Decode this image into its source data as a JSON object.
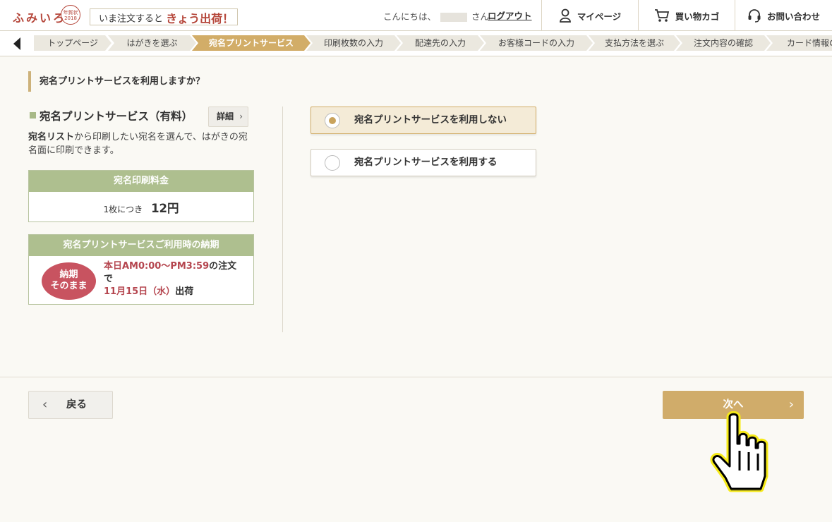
{
  "header": {
    "logo_text": "ふみいろ",
    "logo_seal": "年賀状2018",
    "banner_prefix": "いま注文すると",
    "banner_highlight": "きょう出荷！",
    "greeting_prefix": "こんにちは、",
    "greeting_suffix": "さん",
    "logout": "ログアウト",
    "nav": {
      "mypage": "マイページ",
      "cart": "買い物カゴ",
      "inquiry": "お問い合わせ"
    }
  },
  "breadcrumb": [
    "トップページ",
    "はがきを選ぶ",
    "宛名プリントサービス",
    "印刷枚数の入力",
    "配達先の入力",
    "お客様コードの入力",
    "支払方法を選ぶ",
    "注文内容の確認",
    "カード情報の"
  ],
  "breadcrumb_active_index": 2,
  "main": {
    "question": "宛名プリントサービスを利用しますか？",
    "service_title": "宛名プリントサービス（有料）",
    "detail_button": "詳細",
    "desc_bold": "宛名リスト",
    "desc_rest": "から印刷したい宛名を選んで、はがきの宛名面に印刷できます。",
    "price_box": {
      "title": "宛名印刷料金",
      "unit_label": "1枚につき",
      "price": "12円"
    },
    "delivery_box": {
      "title": "宛名プリントサービスご利用時の納期",
      "badge_line1": "納期",
      "badge_line2": "そのまま",
      "time_range": "本日AM0:00〜PM3:59",
      "order_suffix": "の注文で",
      "ship_date": "11月15日（水）",
      "ship_suffix": "出荷"
    },
    "options": [
      {
        "label": "宛名プリントサービスを利用しない",
        "selected": true
      },
      {
        "label": "宛名プリントサービスを利用する",
        "selected": false
      }
    ]
  },
  "footer": {
    "back_label": "戻る",
    "next_label": "次へ"
  },
  "colors": {
    "accent_gold": "#d0ac6a",
    "green_header": "#aebf8f",
    "brand_red": "#b5463a",
    "badge_red": "#c85360"
  }
}
